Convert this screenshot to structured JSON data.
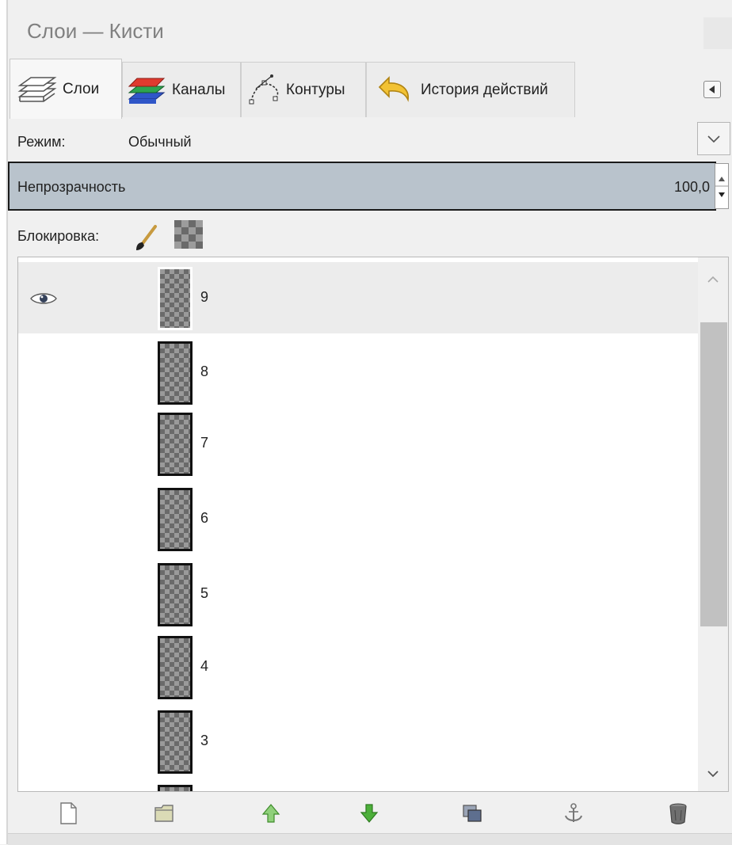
{
  "window": {
    "title": "Слои — Кисти"
  },
  "tabs": [
    {
      "label": "Слои",
      "icon": "layers-icon",
      "active": true
    },
    {
      "label": "Каналы",
      "icon": "channels-icon",
      "active": false
    },
    {
      "label": "Контуры",
      "icon": "paths-icon",
      "active": false
    },
    {
      "label": "История действий",
      "icon": "undo-history-icon",
      "active": false
    }
  ],
  "mode": {
    "label": "Режим:",
    "value": "Обычный"
  },
  "opacity": {
    "label": "Непрозрачность",
    "value": "100,0"
  },
  "lock": {
    "label": "Блокировка:",
    "icons": [
      "lock-pixels-brush-icon",
      "lock-alpha-checker-icon"
    ]
  },
  "layers": [
    {
      "name": "9",
      "visible": true,
      "selected": true
    },
    {
      "name": "8",
      "visible": false,
      "selected": false
    },
    {
      "name": "7",
      "visible": false,
      "selected": false
    },
    {
      "name": "6",
      "visible": false,
      "selected": false
    },
    {
      "name": "5",
      "visible": false,
      "selected": false
    },
    {
      "name": "4",
      "visible": false,
      "selected": false
    },
    {
      "name": "3",
      "visible": false,
      "selected": false
    }
  ],
  "toolbar": {
    "buttons": [
      "new-layer-icon",
      "new-layer-group-icon",
      "raise-layer-icon",
      "lower-layer-icon",
      "duplicate-layer-icon",
      "anchor-layer-icon",
      "delete-layer-icon"
    ]
  },
  "colors": {
    "opacity_bar": "#b9c3cc",
    "selected_row": "#ececec",
    "arrow_green": "#4caf3a"
  }
}
